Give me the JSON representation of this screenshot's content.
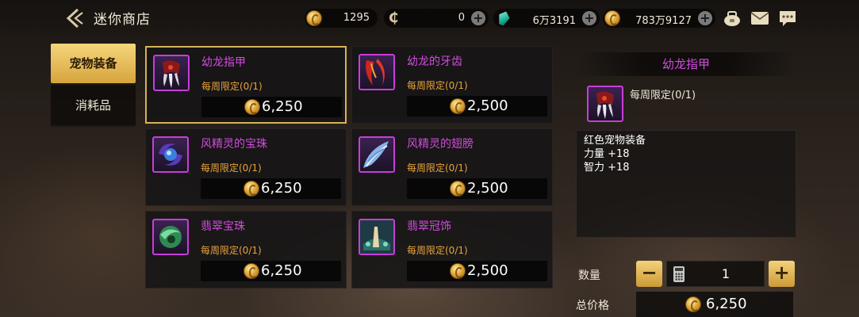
{
  "header": {
    "title": "迷你商店",
    "currencies": [
      {
        "icon": "gold-coin-icon",
        "value": "1295"
      },
      {
        "icon": "c-token-icon",
        "value": "0"
      },
      {
        "icon": "emerald-gem-icon",
        "value": "6万3191"
      },
      {
        "icon": "gold-coin-icon",
        "value": "783万9127"
      }
    ],
    "icons": [
      "bag-icon",
      "mail-icon",
      "chat-icon"
    ]
  },
  "tabs": [
    {
      "label": "宠物装备",
      "active": true
    },
    {
      "label": "消耗品",
      "active": false
    }
  ],
  "items": [
    {
      "name": "幼龙指甲",
      "limit": "每周限定(0/1)",
      "price": "6,250",
      "icon": "dragon-claw-icon",
      "selected": true
    },
    {
      "name": "幼龙的牙齿",
      "limit": "每周限定(0/1)",
      "price": "2,500",
      "icon": "dragon-fang-icon",
      "selected": false
    },
    {
      "name": "风精灵的宝珠",
      "limit": "每周限定(0/1)",
      "price": "6,250",
      "icon": "wind-orb-icon",
      "selected": false
    },
    {
      "name": "风精灵的翅膀",
      "limit": "每周限定(0/1)",
      "price": "2,500",
      "icon": "wind-wing-icon",
      "selected": false
    },
    {
      "name": "翡翠宝珠",
      "limit": "每周限定(0/1)",
      "price": "6,250",
      "icon": "jade-orb-icon",
      "selected": false
    },
    {
      "name": "翡翠冠饰",
      "limit": "每周限定(0/1)",
      "price": "2,500",
      "icon": "jade-crest-icon",
      "selected": false
    }
  ],
  "detail": {
    "title": "幼龙指甲",
    "limit": "每周限定(0/1)",
    "description": [
      "红色宠物装备",
      "力量 +18",
      "智力 +18"
    ]
  },
  "purchase": {
    "qty_label": "数量",
    "quantity": "1",
    "minus": "−",
    "plus": "+",
    "total_label": "总价格",
    "total": "6,250"
  },
  "colors": {
    "item_name": "#d24be0",
    "limit_text": "#e8a33c",
    "accent_gold": "#d6a43d"
  }
}
